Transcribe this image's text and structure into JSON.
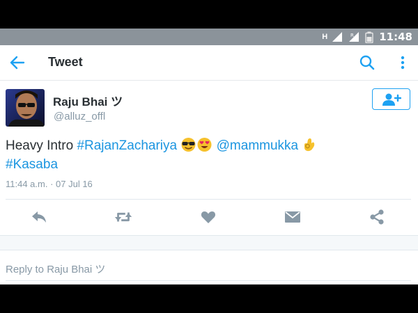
{
  "status_bar": {
    "network": "H",
    "time": "11:48",
    "roaming": "R"
  },
  "app_bar": {
    "title": "Tweet"
  },
  "tweet": {
    "author": {
      "name": "Raju Bhai ツ",
      "handle": "@alluz_offl"
    },
    "text": {
      "word": "Heavy Intro",
      "hashtag1": "#RajanZachariya",
      "mention": "@mammukka",
      "hashtag2": "#Kasaba"
    },
    "timestamp": "11:44 a.m. · 07 Jul 16"
  },
  "actions": [
    "reply",
    "retweet",
    "like",
    "direct-message",
    "share"
  ],
  "reply": {
    "placeholder": "Reply to Raju Bhai ツ"
  },
  "colors": {
    "accent": "#1da1f2",
    "link": "#1b95e0",
    "action_icon": "#8899a6",
    "status_bar": "#8b939a"
  }
}
